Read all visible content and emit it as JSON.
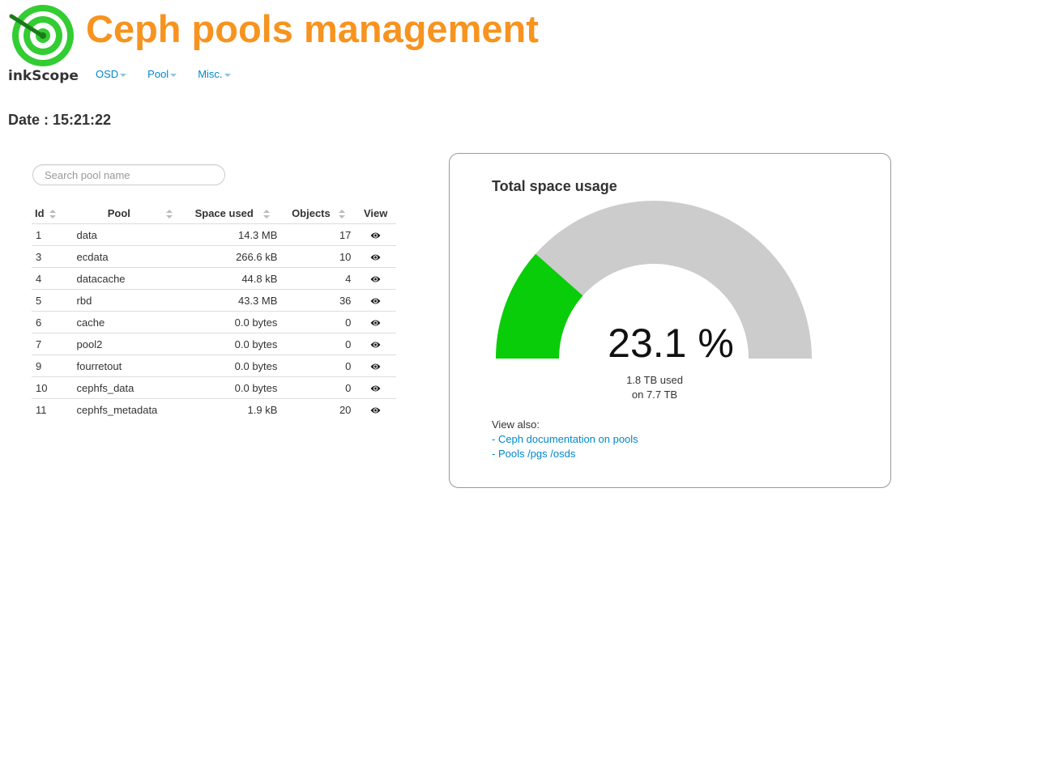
{
  "app": {
    "title": "Ceph pools management",
    "logo_text": "inkScope"
  },
  "nav": {
    "items": [
      "OSD",
      "Pool",
      "Misc."
    ]
  },
  "date": {
    "label": "Date : 15:21:22"
  },
  "search": {
    "placeholder": "Search pool name",
    "value": ""
  },
  "table": {
    "headers": {
      "id": "Id",
      "pool": "Pool",
      "space": "Space used",
      "objects": "Objects",
      "view": "View"
    },
    "rows": [
      {
        "id": "1",
        "pool": "data",
        "space": "14.3 MB",
        "objects": "17"
      },
      {
        "id": "3",
        "pool": "ecdata",
        "space": "266.6 kB",
        "objects": "10"
      },
      {
        "id": "4",
        "pool": "datacache",
        "space": "44.8 kB",
        "objects": "4"
      },
      {
        "id": "5",
        "pool": "rbd",
        "space": "43.3 MB",
        "objects": "36"
      },
      {
        "id": "6",
        "pool": "cache",
        "space": "0.0 bytes",
        "objects": "0"
      },
      {
        "id": "7",
        "pool": "pool2",
        "space": "0.0 bytes",
        "objects": "0"
      },
      {
        "id": "9",
        "pool": "fourretout",
        "space": "0.0 bytes",
        "objects": "0"
      },
      {
        "id": "10",
        "pool": "cephfs_data",
        "space": "0.0 bytes",
        "objects": "0"
      },
      {
        "id": "11",
        "pool": "cephfs_metadata",
        "space": "1.9 kB",
        "objects": "20"
      }
    ]
  },
  "usage": {
    "title": "Total space usage",
    "percent": 23.1,
    "percent_label": "23.1 %",
    "used_label": "1.8 TB used",
    "total_label": "on 7.7 TB",
    "fill_color": "#0acd0a",
    "track_color": "#cccccc"
  },
  "view_also": {
    "label": "View also:",
    "links": [
      "- Ceph documentation on pools",
      "- Pools /pgs /osds"
    ]
  },
  "colors": {
    "title": "#f7931e",
    "link": "#0088cc"
  },
  "icons": {
    "view": "eye-icon",
    "logo": "target-logo-icon"
  }
}
